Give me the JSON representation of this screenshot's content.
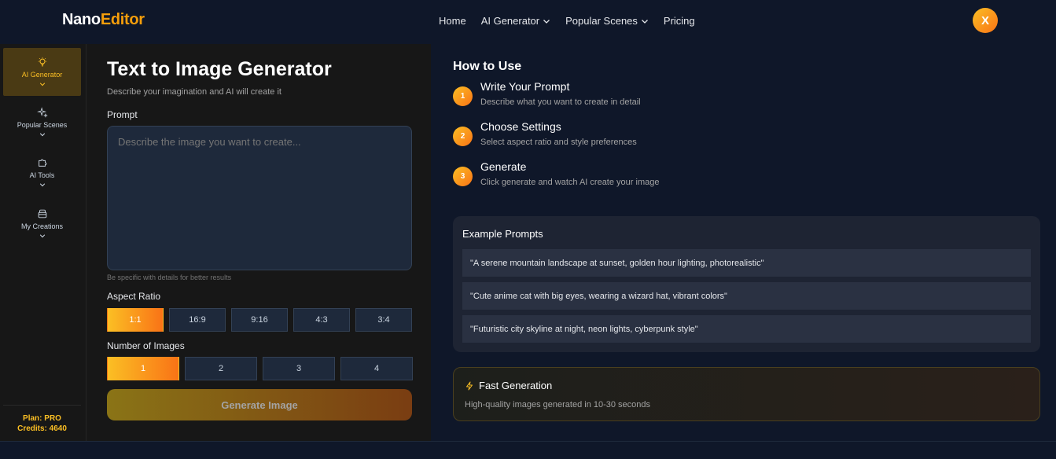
{
  "brand": {
    "part1": "Nano",
    "part2": "Editor"
  },
  "nav": {
    "items": [
      {
        "label": "Home",
        "has_dropdown": false
      },
      {
        "label": "AI Generator",
        "has_dropdown": true
      },
      {
        "label": "Popular Scenes",
        "has_dropdown": true
      },
      {
        "label": "Pricing",
        "has_dropdown": false
      }
    ]
  },
  "user": {
    "avatar_letter": "X"
  },
  "sidebar": {
    "items": [
      {
        "label": "AI Generator",
        "icon": "lightbulb-icon",
        "active": true
      },
      {
        "label": "Popular Scenes",
        "icon": "sparkles-icon",
        "active": false
      },
      {
        "label": "AI Tools",
        "icon": "puzzle-icon",
        "active": false
      },
      {
        "label": "My Creations",
        "icon": "archive-icon",
        "active": false
      }
    ],
    "plan": "Plan: PRO",
    "credits": "Credits: 4640"
  },
  "generator": {
    "title": "Text to Image Generator",
    "subtitle": "Describe your imagination and AI will create it",
    "prompt_label": "Prompt",
    "prompt_placeholder": "Describe the image you want to create...",
    "prompt_value": "",
    "hint": "Be specific with details for better results",
    "aspect_label": "Aspect Ratio",
    "aspect_options": [
      "1:1",
      "16:9",
      "9:16",
      "4:3",
      "3:4"
    ],
    "aspect_selected": "1:1",
    "count_label": "Number of Images",
    "count_options": [
      "1",
      "2",
      "3",
      "4"
    ],
    "count_selected": "1",
    "generate_label": "Generate Image"
  },
  "how_to": {
    "title": "How to Use",
    "steps": [
      {
        "num": "1",
        "title": "Write Your Prompt",
        "desc": "Describe what you want to create in detail"
      },
      {
        "num": "2",
        "title": "Choose Settings",
        "desc": "Select aspect ratio and style preferences"
      },
      {
        "num": "3",
        "title": "Generate",
        "desc": "Click generate and watch AI create your image"
      }
    ]
  },
  "examples": {
    "title": "Example Prompts",
    "items": [
      "\"A serene mountain landscape at sunset, golden hour lighting, photorealistic\"",
      "\"Cute anime cat with big eyes, wearing a wizard hat, vibrant colors\"",
      "\"Futuristic city skyline at night, neon lights, cyberpunk style\""
    ]
  },
  "fast": {
    "title": "Fast Generation",
    "desc": "High-quality images generated in 10-30 seconds"
  },
  "colors": {
    "background": "#0f1729",
    "panel": "#171717",
    "accent": "#fbbf24",
    "accent2": "#f97316"
  }
}
